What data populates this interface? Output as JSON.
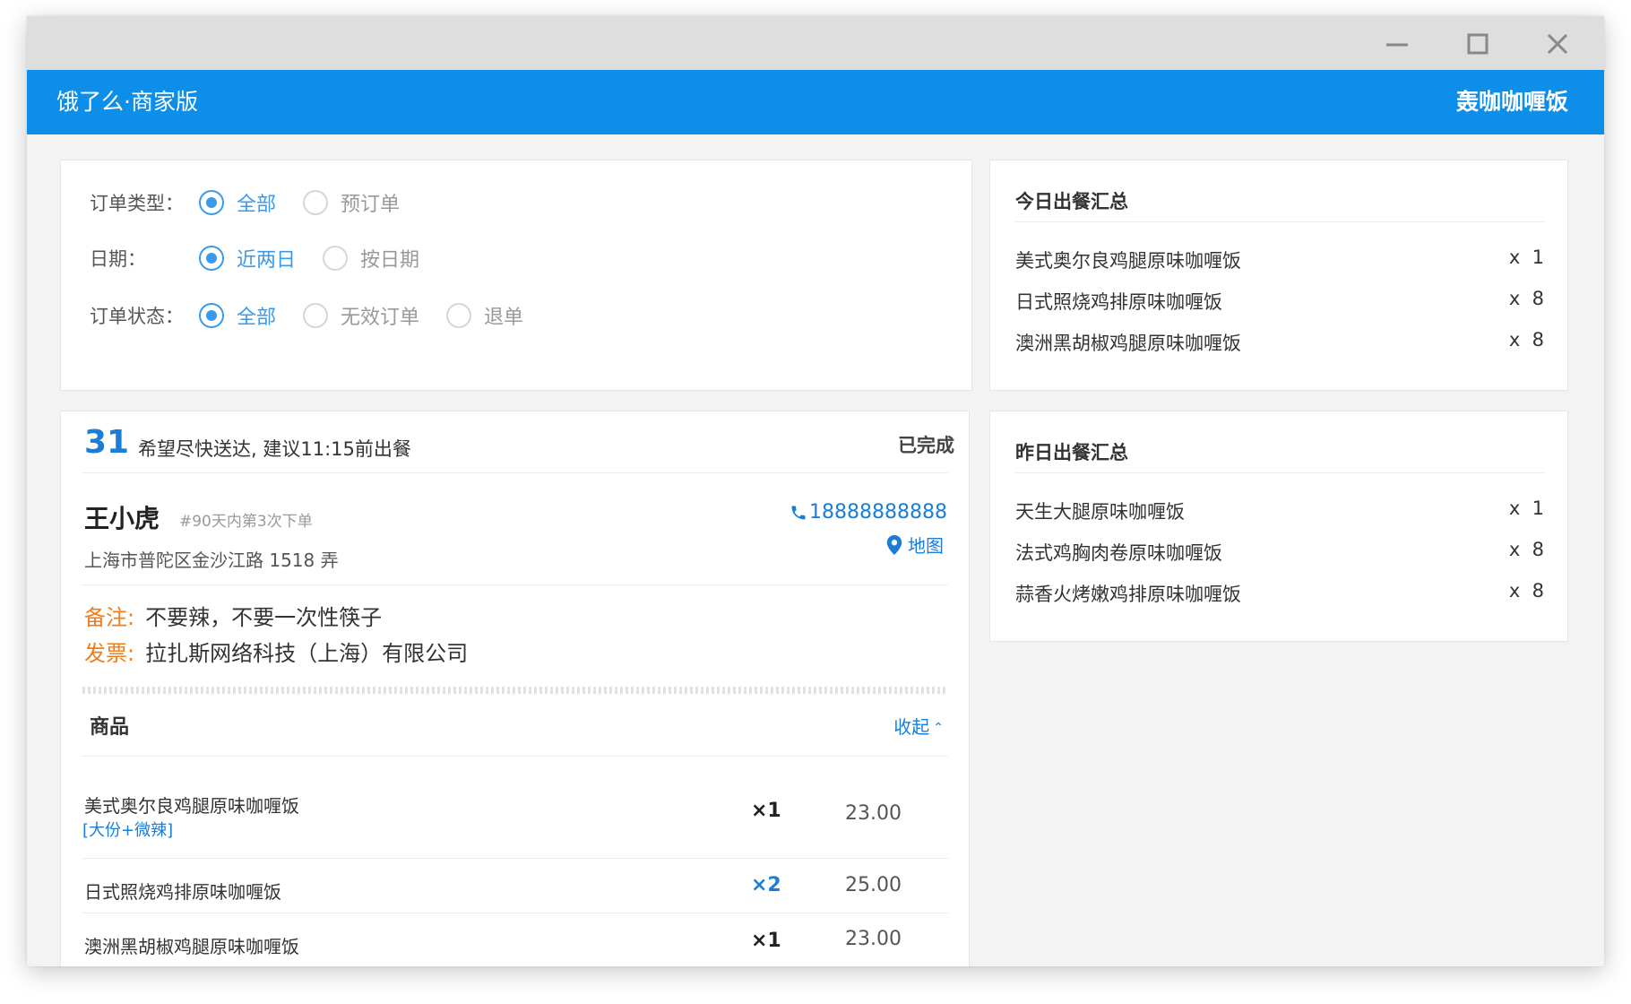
{
  "header": {
    "brand": "饿了么·商家版",
    "shop": "轰咖咖喱饭",
    "color": "#0d8ee9"
  },
  "filters": {
    "order_type": {
      "label": "订单类型：",
      "options": [
        {
          "label": "全部",
          "selected": true
        },
        {
          "label": "预订单",
          "selected": false
        }
      ]
    },
    "date": {
      "label": "日期：",
      "options": [
        {
          "label": "近两日",
          "selected": true
        },
        {
          "label": "按日期",
          "selected": false
        }
      ]
    },
    "order_status": {
      "label": "订单状态：",
      "options": [
        {
          "label": "全部",
          "selected": true
        },
        {
          "label": "无效订单",
          "selected": false
        },
        {
          "label": "退单",
          "selected": false
        }
      ]
    }
  },
  "order": {
    "number": "31",
    "hint": "希望尽快送达, 建议11:15前出餐",
    "status": "已完成",
    "customer": {
      "name": "王小虎",
      "note": "#90天内第3次下单",
      "address": "上海市普陀区金沙江路 1518 弄",
      "phone": "18888888888",
      "map": "地图"
    },
    "remark_label": "备注:",
    "remark": "不要辣，不要一次性筷子",
    "invoice_label": "发票:",
    "invoice": "拉扎斯网络科技（上海）有限公司",
    "goods_title": "商品",
    "collapse": "收起",
    "items": [
      {
        "name": "美式奥尔良鸡腿原味咖喱饭",
        "spec": "[大份+微辣]",
        "qty": "×1",
        "price": "23.00"
      },
      {
        "name": "日式照烧鸡排原味咖喱饭",
        "qty": "×2",
        "price": "25.00"
      },
      {
        "name": "澳洲黑胡椒鸡腿原味咖喱饭",
        "qty": "×1",
        "price": "23.00"
      }
    ]
  },
  "today_summary": {
    "title": "今日出餐汇总",
    "rows": [
      {
        "name": "美式奥尔良鸡腿原味咖喱饭",
        "qty": "x  1"
      },
      {
        "name": "日式照烧鸡排原味咖喱饭",
        "qty": "x  8"
      },
      {
        "name": "澳洲黑胡椒鸡腿原味咖喱饭",
        "qty": "x  8"
      }
    ]
  },
  "yesterday_summary": {
    "title": "昨日出餐汇总",
    "rows": [
      {
        "name": "天生大腿原味咖喱饭",
        "qty": "x  1"
      },
      {
        "name": "法式鸡胸肉卷原味咖喱饭",
        "qty": "x  8"
      },
      {
        "name": "蒜香火烤嫩鸡排原味咖喱饭",
        "qty": "x  8"
      }
    ]
  }
}
